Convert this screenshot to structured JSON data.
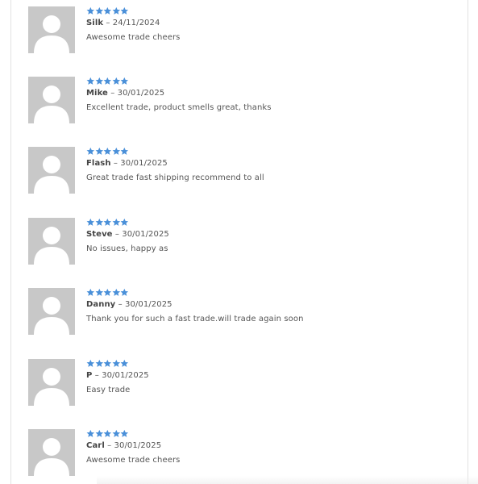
{
  "colors": {
    "star": "#4a90d9",
    "avatar_bg": "#c8c8c8",
    "text": "#555555"
  },
  "separator": "–",
  "reviews": [
    {
      "author": "Silk",
      "date": "24/11/2024",
      "text": "Awesome trade cheers",
      "rating": 5
    },
    {
      "author": "Mike",
      "date": "30/01/2025",
      "text": "Excellent trade, product smells great, thanks",
      "rating": 5
    },
    {
      "author": "Flash",
      "date": "30/01/2025",
      "text": "Great trade fast shipping recommend to all",
      "rating": 5
    },
    {
      "author": "Steve",
      "date": "30/01/2025",
      "text": "No issues, happy as",
      "rating": 5
    },
    {
      "author": "Danny",
      "date": "30/01/2025",
      "text": "Thank you for such a fast trade.will trade again soon",
      "rating": 5
    },
    {
      "author": "P",
      "date": "30/01/2025",
      "text": "Easy trade",
      "rating": 5
    },
    {
      "author": "Carl",
      "date": "30/01/2025",
      "text": "Awesome trade cheers",
      "rating": 5
    }
  ]
}
